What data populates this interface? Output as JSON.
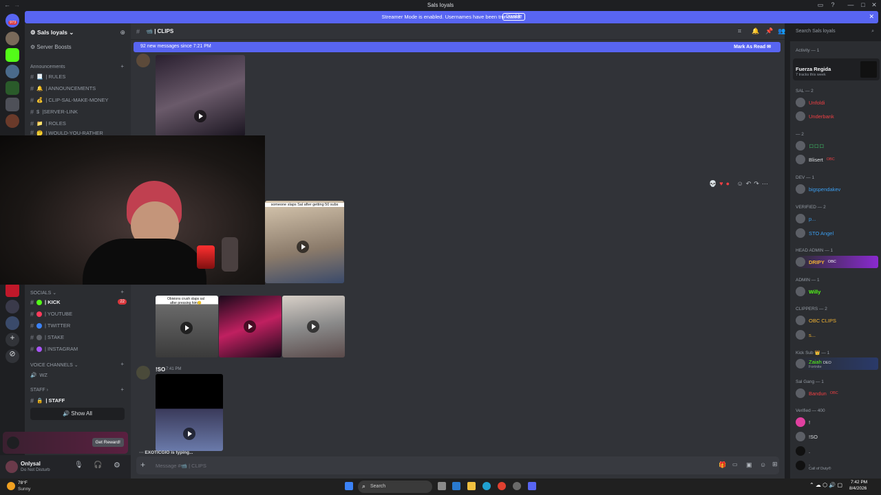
{
  "window": {
    "title": "Sals loyals"
  },
  "banner": {
    "message": "Streamer Mode is enabled. Usernames have been truncated.",
    "disable_label": "Disable"
  },
  "guild_badge": "973",
  "sidebar": {
    "server_name": "Sals loyals",
    "boosts": "Server Boosts",
    "category_announcements": "Announcements",
    "channels": [
      {
        "name": "| RULES",
        "emoji": "📃"
      },
      {
        "name": "| ANNOUNCEMENTS",
        "emoji": "🔔"
      },
      {
        "name": "| CLIP-SAL-MAKE-MONEY",
        "emoji": "💰"
      },
      {
        "name": "|SERVER-LINK",
        "emoji": "$"
      },
      {
        "name": "| ROLES",
        "emoji": "📁"
      },
      {
        "name": "| WOULD-YOU-RATHER",
        "emoji": "🤔"
      }
    ],
    "category_socials": "SOCIALS",
    "socials": [
      {
        "name": "| KICK",
        "badge": "22",
        "color": "#53fc18"
      },
      {
        "name": "| YOUTUBE",
        "color": "#ff3b5c"
      },
      {
        "name": "| TWITTER",
        "color": "#3b82f6"
      },
      {
        "name": "| STAKE",
        "color": "#5c5f66"
      },
      {
        "name": "| INSTAGRAM",
        "color": "#a855f7"
      }
    ],
    "category_voice": "VOICE CHANNELS",
    "voice": [
      {
        "name": "WZ"
      }
    ],
    "category_staff": "STAFF",
    "staff": [
      {
        "name": "| STAFF"
      }
    ],
    "show_all": "Show All",
    "reward_button": "Get Reward!",
    "user": {
      "name": "Onlysal",
      "status": "Do Not Disturb"
    }
  },
  "main": {
    "channel_name": "| CLIPS",
    "new_messages": "92 new messages since 7:21 PM",
    "mark_read": "Mark As Read",
    "clip_caption": "Obivions crush slaps sal after pressing him🙂",
    "clip_top_caption": "someone slaps Sal after getting 50 subs",
    "message_author": "!SO",
    "message_time": "7:41 PM",
    "typing": "EXOTICGIO is typing...",
    "composer_placeholder": "Message #📹 | CLIPS"
  },
  "topbar": {
    "search_placeholder": "Search Sals loyals"
  },
  "members": {
    "activity_header": "Activity — 1",
    "activity_title": "Fuerza Regida",
    "activity_sub": "7 tracks this week",
    "groups": [
      {
        "header": "SAL — 2",
        "items": [
          {
            "name": "Unfoldi",
            "color": "#f23f43"
          },
          {
            "name": "Underbank",
            "color": "#f23f43"
          }
        ]
      },
      {
        "header": "— 2",
        "items": [
          {
            "name": "ロロロ",
            "color": "#3ba55d"
          },
          {
            "name": "Blisert",
            "tag": "OBC",
            "color": "#dbdee1"
          }
        ]
      },
      {
        "header": "DEV — 1",
        "items": [
          {
            "name": "bigspendakev",
            "color": "#3b9ef0"
          }
        ]
      },
      {
        "header": "VERIFIED — 2",
        "items": [
          {
            "name": "p...",
            "color": "#3b9ef0"
          },
          {
            "name": "STO Angel",
            "color": "#3b9ef0"
          }
        ]
      },
      {
        "header": "HEAD ADMIN — 1",
        "items": [
          {
            "name": "DRIPY",
            "tag": "OBC",
            "color": "#f0b232"
          }
        ]
      },
      {
        "header": "ADMIN — 1",
        "items": [
          {
            "name": "Willy",
            "color": "#53fc18"
          }
        ]
      },
      {
        "header": "CLIPPERS — 2",
        "items": [
          {
            "name": "OBC CLIPS",
            "color": "#f0b232"
          },
          {
            "name": "s...",
            "color": "#f0b232"
          }
        ]
      },
      {
        "header": "Kick Sub 👑 — 1",
        "items": [
          {
            "name": "Zaiah",
            "tag": "DEO",
            "sub": "Fortnite",
            "color": "#53fc18"
          }
        ]
      },
      {
        "header": "Sal Gang — 1",
        "items": [
          {
            "name": "Bandun",
            "tag": "OBC",
            "color": "#f23f43"
          }
        ]
      },
      {
        "header": "Verified — 400",
        "items": [
          {
            "name": "!",
            "color": "#dbdee1"
          },
          {
            "name": "!SO",
            "color": "#dbdee1"
          },
          {
            "name": ".",
            "color": "#dbdee1"
          },
          {
            "name": ".",
            "sub": "Call of Duty®",
            "color": "#dbdee1"
          }
        ]
      }
    ]
  },
  "taskbar": {
    "weather_temp": "78°F",
    "weather_desc": "Sunny",
    "search_placeholder": "Search",
    "time": "7:42 PM",
    "date": "8/4/2026"
  }
}
